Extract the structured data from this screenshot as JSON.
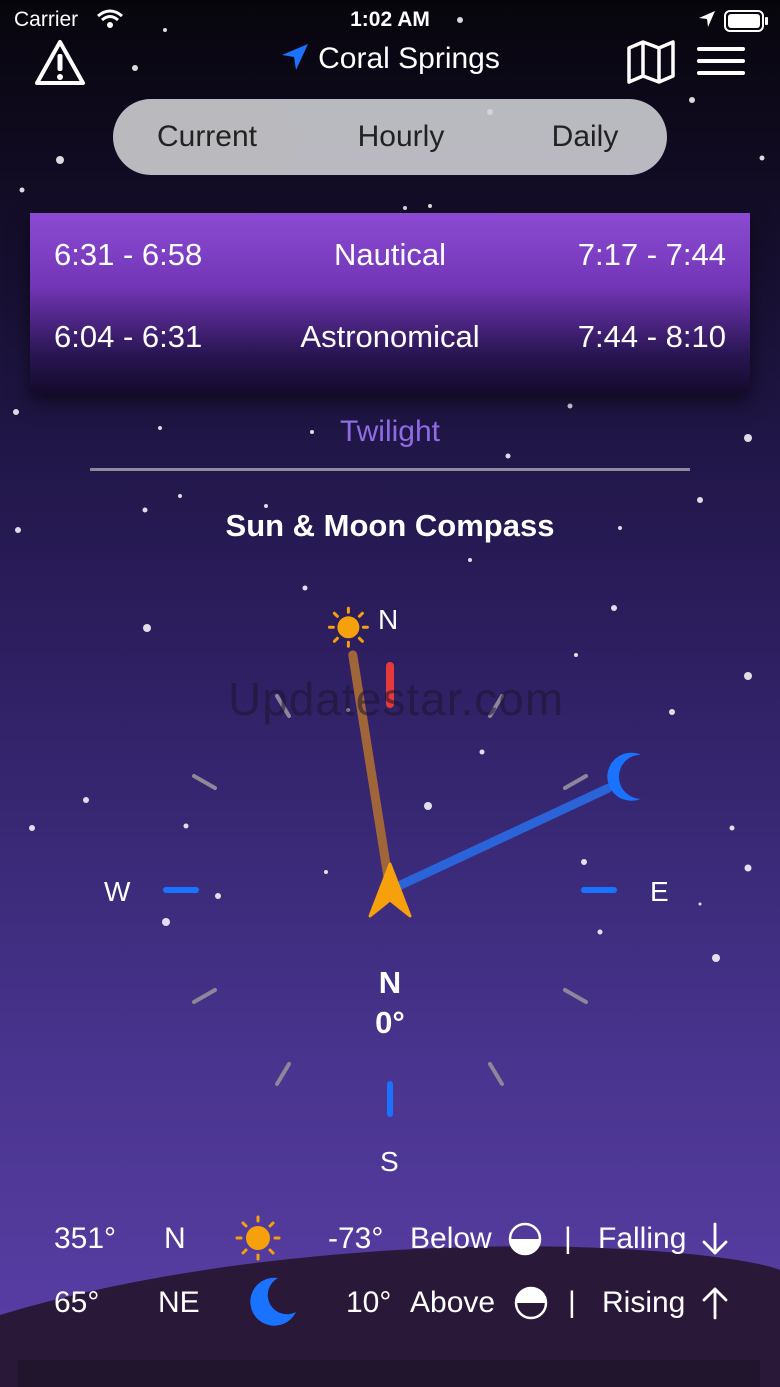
{
  "status_bar": {
    "carrier": "Carrier",
    "time": "1:02 AM"
  },
  "header": {
    "location": "Coral Springs",
    "icons": [
      "warning-icon",
      "location-arrow-icon",
      "map-icon",
      "menu-icon"
    ]
  },
  "tabs": [
    {
      "label": "Current",
      "selected": true
    },
    {
      "label": "Hourly",
      "selected": false
    },
    {
      "label": "Daily",
      "selected": false
    }
  ],
  "twilight_card": {
    "rows": [
      {
        "morning": "6:31 - 6:58",
        "name": "Nautical",
        "evening": "7:17 - 7:44"
      },
      {
        "morning": "6:04 - 6:31",
        "name": "Astronomical",
        "evening": "7:44 - 8:10"
      }
    ]
  },
  "section_label": "Twilight",
  "compass": {
    "title": "Sun & Moon Compass",
    "dir_n": "N",
    "dir_e": "E",
    "dir_s": "S",
    "dir_w": "W",
    "heading_dir": "N",
    "heading_deg": "0°",
    "sun_azimuth": 351,
    "moon_azimuth": 65
  },
  "sun_row": {
    "azimuth": "351°",
    "direction": "N",
    "icon": "sun-icon",
    "altitude": "-73°",
    "position": "Below",
    "separator": "|",
    "trend": "Falling"
  },
  "moon_row": {
    "azimuth": "65°",
    "direction": "NE",
    "icon": "moon-icon",
    "altitude": "10°",
    "position": "Above",
    "separator": "|",
    "trend": "Rising"
  },
  "watermark": "Updatestar.com",
  "colors": {
    "accent_blue": "#1a73ff",
    "sun_orange": "#f6a00c",
    "twilight_purple": "#8f6be6",
    "north_red": "#e53a3a"
  }
}
